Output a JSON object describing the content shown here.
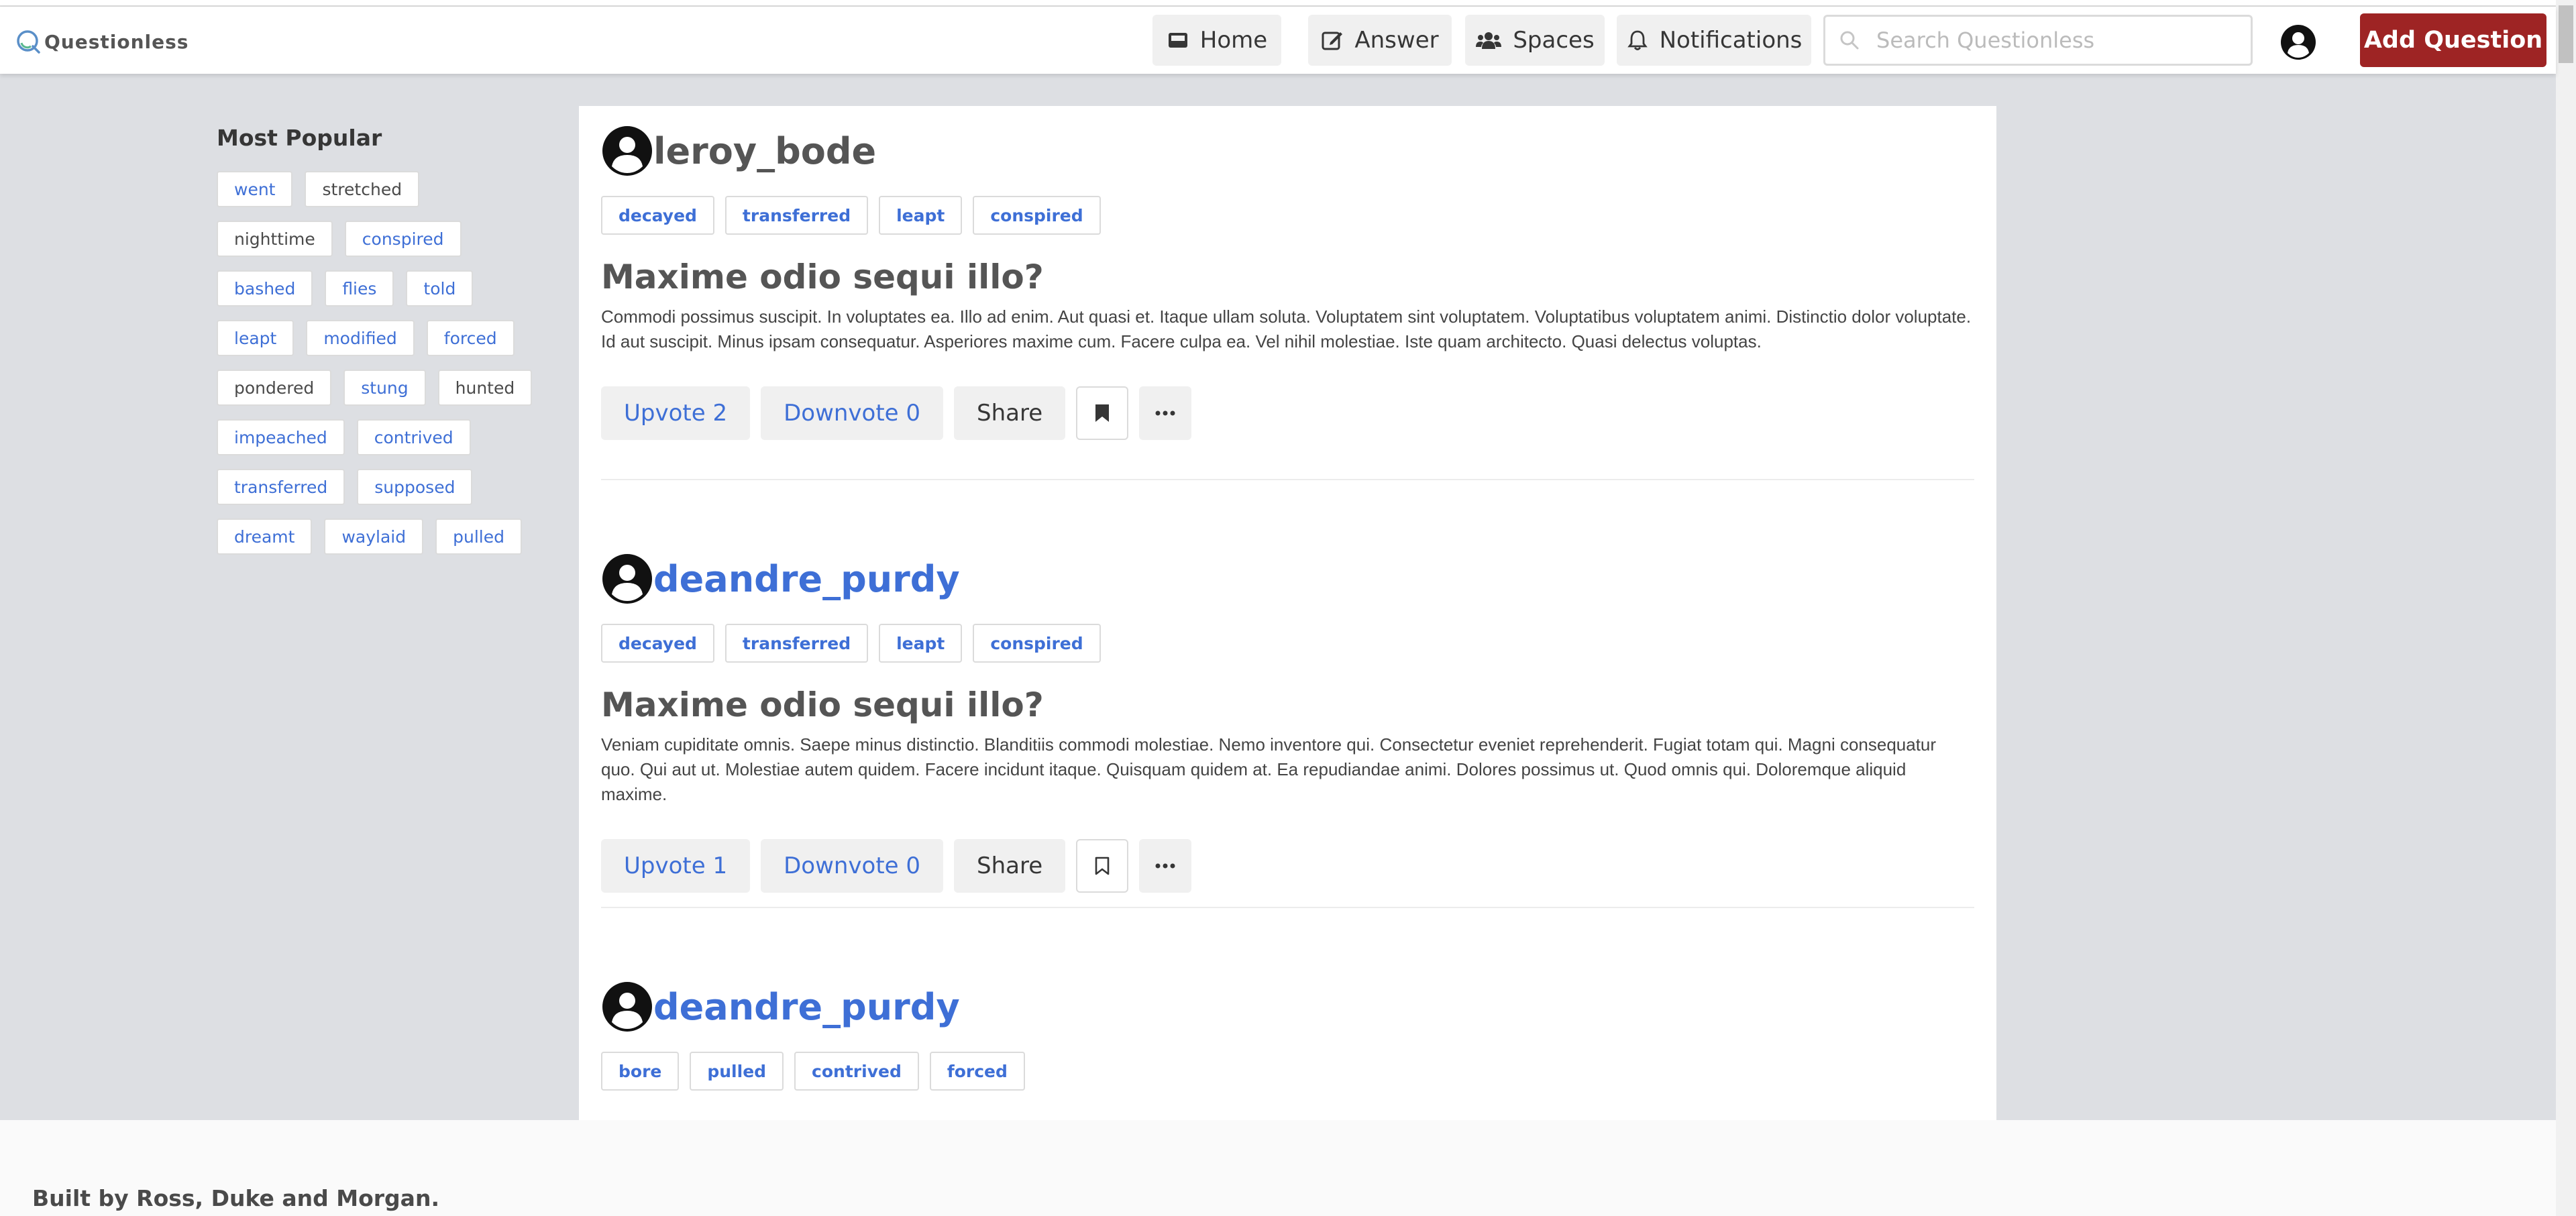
{
  "brand": {
    "name": "Questionless"
  },
  "nav": {
    "home": "Home",
    "answer": "Answer",
    "spaces": "Spaces",
    "notifications": "Notifications",
    "search_placeholder": "Search Questionless",
    "add_question": "Add Question"
  },
  "sidebar": {
    "title": "Most Popular",
    "tags": [
      "went",
      "stretched",
      "nighttime",
      "conspired",
      "bashed",
      "flies",
      "told",
      "leapt",
      "modified",
      "forced",
      "pondered",
      "stung",
      "hunted",
      "impeached",
      "contrived",
      "transferred",
      "supposed",
      "dreamt",
      "waylaid",
      "pulled"
    ]
  },
  "posts": [
    {
      "username": "leroy_bode",
      "tags": [
        "decayed",
        "transferred",
        "leapt",
        "conspired"
      ],
      "title": "Maxime odio sequi illo?",
      "body": "Commodi possimus suscipit. In voluptates ea. Illo ad enim. Aut quasi et. Itaque ullam soluta. Voluptatem sint voluptatem. Voluptatibus voluptatem animi. Distinctio dolor voluptate. Id aut suscipit. Minus ipsam consequatur. Asperiores maxime cum. Facere culpa ea. Vel nihil molestiae. Iste quam architecto. Quasi delectus voluptas.",
      "upvote": "Upvote 2",
      "downvote": "Downvote 0",
      "share": "Share",
      "bookmarked": true
    },
    {
      "username": "deandre_purdy",
      "tags": [
        "decayed",
        "transferred",
        "leapt",
        "conspired"
      ],
      "title": "Maxime odio sequi illo?",
      "body": "Veniam cupiditate omnis. Saepe minus distinctio. Blanditiis commodi molestiae. Nemo inventore qui. Consectetur eveniet reprehenderit. Fugiat totam qui. Magni consequatur quo. Qui aut ut. Molestiae autem quidem. Facere incidunt itaque. Quisquam quidem at. Ea repudiandae animi. Dolores possimus ut. Quod omnis qui. Doloremque aliquid maxime.",
      "upvote": "Upvote 1",
      "downvote": "Downvote 0",
      "share": "Share",
      "bookmarked": false
    },
    {
      "username": "deandre_purdy",
      "tags": [
        "bore",
        "pulled",
        "contrived",
        "forced"
      ]
    }
  ],
  "footer": {
    "prefix": "Built by ",
    "name1": "Ross",
    "sep1": ", ",
    "name2": "Duke",
    "sep2": " and ",
    "name3": "Morgan",
    "suffix": "."
  },
  "colors": {
    "accent": "#3e6fd6",
    "brand_button": "#9e2424",
    "main_bg": "#dddfe3"
  }
}
